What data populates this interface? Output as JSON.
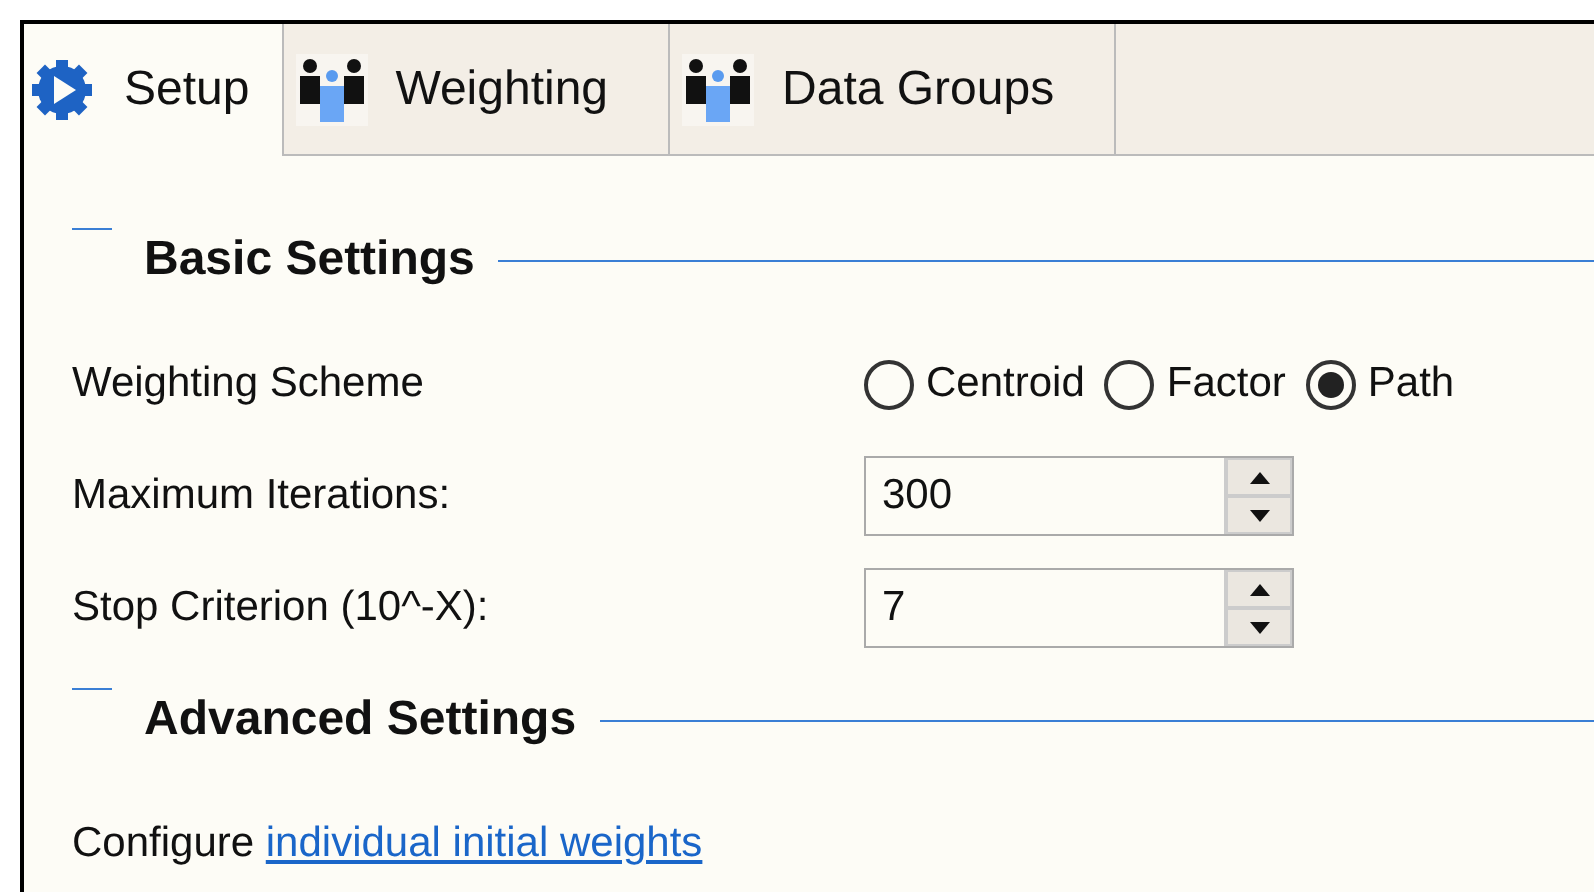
{
  "tabs": [
    {
      "label": "Setup",
      "kind": "gear",
      "selected": true
    },
    {
      "label": "Weighting",
      "kind": "people",
      "selected": false
    },
    {
      "label": "Data Groups",
      "kind": "people",
      "selected": false
    }
  ],
  "sections": [
    {
      "title": "Basic Settings",
      "rows": [
        {
          "kind": "radio",
          "label": "Weighting Scheme",
          "options": [
            {
              "label": "Centroid",
              "selected": false
            },
            {
              "label": "Factor",
              "selected": false
            },
            {
              "label": "Path",
              "selected": true
            }
          ]
        },
        {
          "kind": "spinner",
          "label": "Maximum Iterations:",
          "value": "300"
        },
        {
          "kind": "spinner",
          "label": "Stop Criterion (10^-X):",
          "value": "7"
        }
      ]
    },
    {
      "title": "Advanced Settings",
      "rows": [
        {
          "kind": "link",
          "text": "Configure",
          "link": "individual initial weights"
        }
      ]
    }
  ]
}
